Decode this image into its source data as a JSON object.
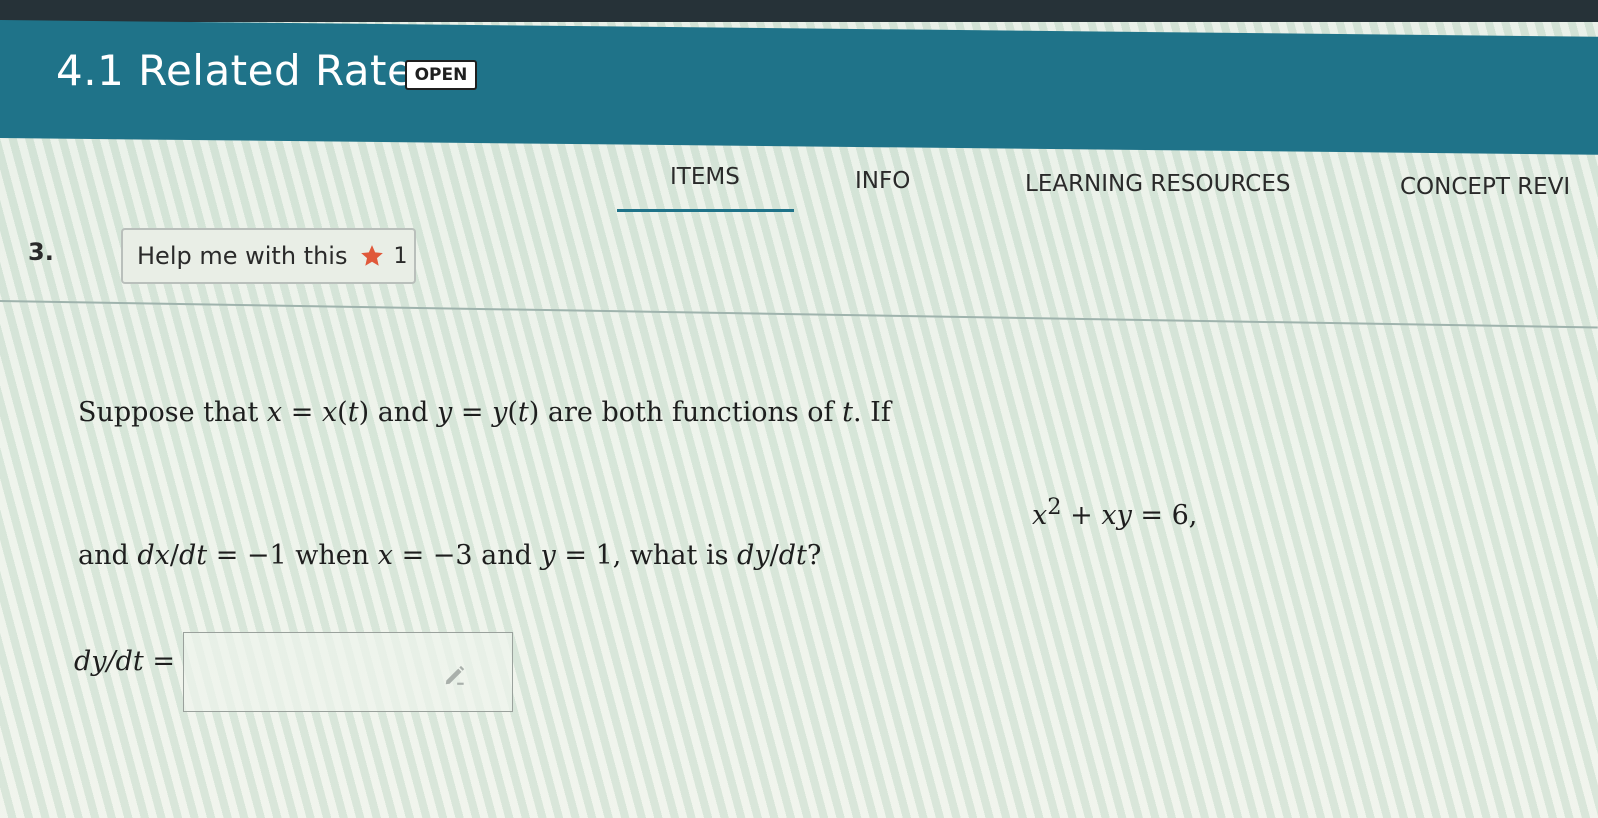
{
  "header": {
    "title": "4.1 Related Rates",
    "status_badge": "OPEN"
  },
  "tabs": [
    {
      "label": "ITEMS",
      "active": true
    },
    {
      "label": "INFO",
      "active": false
    },
    {
      "label": "LEARNING RESOURCES",
      "active": false
    },
    {
      "label": "CONCEPT REVI",
      "active": false
    }
  ],
  "question": {
    "number": "3.",
    "help_button_label": "Help me with this",
    "help_count": "1",
    "line1": {
      "t1": "Suppose that ",
      "m1": "x",
      "t2": " = ",
      "m2": "x",
      "t3": "(",
      "m3": "t",
      "t4": ") and ",
      "m4": "y",
      "t5": " = ",
      "m5": "y",
      "t6": "(",
      "m6": "t",
      "t7": ") are both functions of ",
      "m7": "t",
      "t8": ". If"
    },
    "equation": {
      "m1": "x",
      "sup": "2",
      "t1": " + ",
      "m2": "xy",
      "t2": " = 6,"
    },
    "line2": {
      "t1": "and ",
      "m1": "dx",
      "t2": "/",
      "m2": "dt",
      "t3": " = −1 when ",
      "m3": "x",
      "t4": " = −3 and ",
      "m4": "y",
      "t5": " = 1, what is ",
      "m5": "dy",
      "t6": "/",
      "m6": "dt",
      "t7": "?"
    },
    "answer_label": "dy/dt =",
    "answer_value": ""
  },
  "icons": {
    "star": "star-icon",
    "pencil": "pencil-icon"
  },
  "colors": {
    "header_bg": "#1f7389",
    "tab_underline": "#1f7389",
    "star": "#e0583a"
  }
}
